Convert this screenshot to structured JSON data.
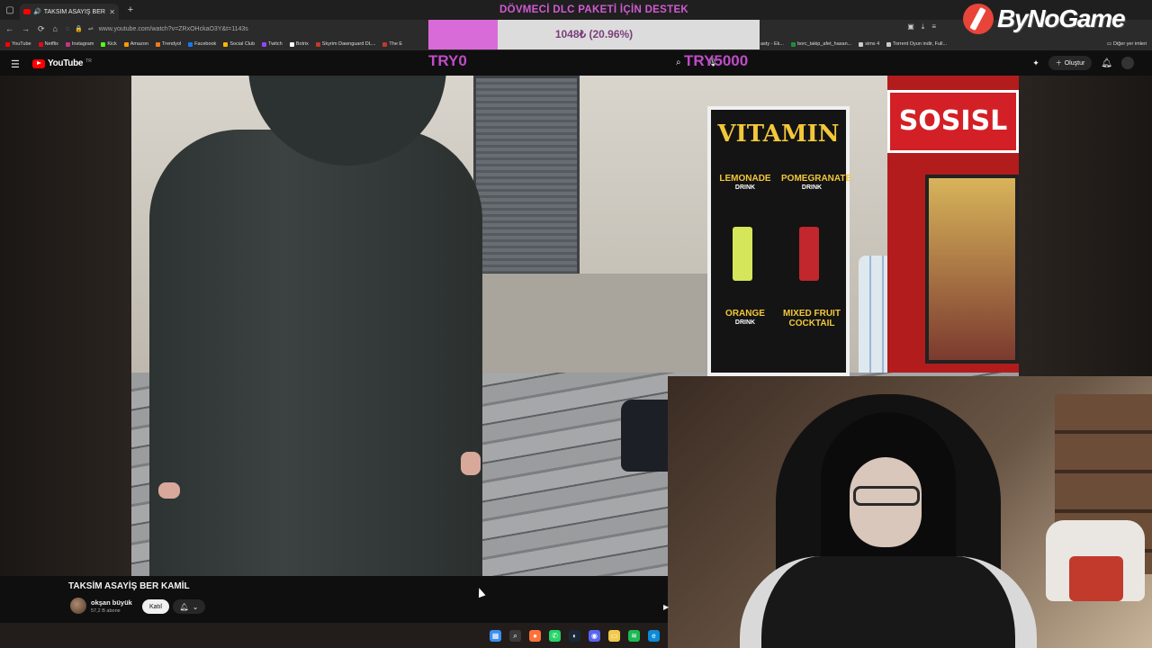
{
  "browser": {
    "tab_title": "TAKSİM ASAYİŞ BER KAMİL",
    "url": "www.youtube.com/watch?v=ZRxOHckaO3Y&t=1143s",
    "bookmarks": [
      {
        "label": "YouTube",
        "color": "#ff0000"
      },
      {
        "label": "Netflix",
        "color": "#e50914"
      },
      {
        "label": "Instagram",
        "color": "#c13584"
      },
      {
        "label": "Kick",
        "color": "#53fc18"
      },
      {
        "label": "Amazon",
        "color": "#ff9900"
      },
      {
        "label": "Trendyol",
        "color": "#f27a1a"
      },
      {
        "label": "Facebook",
        "color": "#1877f2"
      },
      {
        "label": "Social Club",
        "color": "#f5b800"
      },
      {
        "label": "Twitch",
        "color": "#9146ff"
      },
      {
        "label": "Botrix",
        "color": "#ffffff"
      },
      {
        "label": "Skyrim Dawnguard DL...",
        "color": "#c0392b"
      },
      {
        "label": "The E",
        "color": "#c0392b"
      }
    ],
    "bookmarks_right": [
      {
        "label": "asty - Ek...",
        "color": "#777777"
      },
      {
        "label": "borc_takip_afet_hasan...",
        "color": "#1e8e3e"
      },
      {
        "label": "sims 4",
        "color": "#cccccc"
      },
      {
        "label": "Torrent Oyun indir, Full...",
        "color": "#cccccc"
      }
    ],
    "other_bookmarks": "Diğer yer imleri"
  },
  "youtube": {
    "logo": "YouTube",
    "region": "TR",
    "create_label": "Oluştur"
  },
  "donation": {
    "title": "DÖVMECİ DLC PAKETİ İÇİN DESTEK",
    "progress_text": "1048₺ (20.96%)",
    "progress_fraction": 0.2096,
    "goal_min": "TRY0",
    "goal_max": "TRY5000",
    "accent": "#d05ad0"
  },
  "brand": {
    "name": "ByNoGame"
  },
  "video": {
    "stall_title": "VITAMIN",
    "items": [
      "LEMONADE",
      "POMEGRANATE",
      "ORANGE",
      "MIXED FRUIT COCKTAIL"
    ],
    "item_subs": [
      "DRINK",
      "DRINK",
      "DRINK",
      ""
    ],
    "sign": "SOSISL"
  },
  "info": {
    "title": "TAKSİM ASAYİŞ BER KAMİL",
    "channel": "okşan büyük",
    "subscribers": "57,2 B abone",
    "join_label": "Katıl"
  },
  "taskbar": {
    "icons": [
      "windows-start-icon",
      "search-icon",
      "firefox-icon",
      "whatsapp-icon",
      "steam-icon",
      "discord-icon",
      "file-explorer-icon",
      "spotify-icon",
      "edge-icon"
    ]
  }
}
